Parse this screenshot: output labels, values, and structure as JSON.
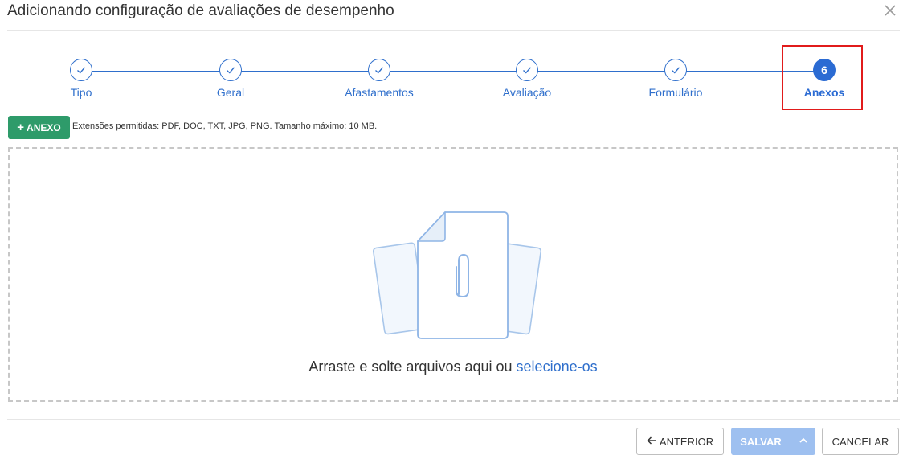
{
  "dialog": {
    "title": "Adicionando configuração de avaliações de desempenho"
  },
  "stepper": {
    "steps": [
      {
        "label": "Tipo",
        "state": "completed"
      },
      {
        "label": "Geral",
        "state": "completed"
      },
      {
        "label": "Afastamentos",
        "state": "completed"
      },
      {
        "label": "Avaliação",
        "state": "completed"
      },
      {
        "label": "Formulário",
        "state": "completed"
      },
      {
        "label": "Anexos",
        "state": "active",
        "number": "6"
      }
    ]
  },
  "attachments": {
    "add_label": "ANEXO",
    "extensions_info": "Extensões permitidas: PDF, DOC, TXT, JPG, PNG. Tamanho máximo: 10 MB.",
    "drop_text": "Arraste e solte arquivos aqui ou",
    "drop_link": "selecione-os"
  },
  "footer": {
    "previous_label": "ANTERIOR",
    "save_label": "SALVAR",
    "cancel_label": "CANCELAR"
  },
  "colors": {
    "accent": "#2f6fcc",
    "add_button": "#2e9b6a",
    "save_button_disabled": "#9ec0f0",
    "highlight": "#e11b1b"
  }
}
